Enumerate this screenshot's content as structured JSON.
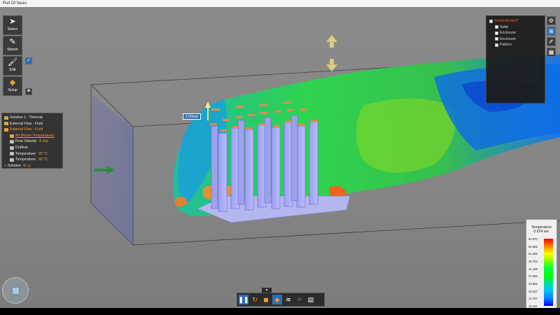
{
  "window": {
    "status_text": "Pull 20 faces"
  },
  "tools": {
    "select_label": "Select",
    "sketch_label": "Sketch",
    "edit_label": "Edit",
    "setup_label": "Setup"
  },
  "simulation_tree": {
    "items": [
      {
        "label": "Solution 1 - Thermal",
        "accent": false
      },
      {
        "label": "External Flow - Fluid",
        "accent": false
      },
      {
        "label": "External Flow - Fluid",
        "accent": true
      },
      {
        "label": "Air [Room Temperature]",
        "accent": true
      },
      {
        "label": "Flow Velocity",
        "value": "6 m/s"
      },
      {
        "label": "Outflow"
      },
      {
        "label": "Temperature",
        "value": "25 °C"
      },
      {
        "label": "Temperature",
        "value": "60 °C"
      }
    ],
    "add_label": "Solution"
  },
  "model_tree": {
    "root": "SimpleModel2*",
    "items": [
      "Solid",
      "Enclosure",
      "Enclosure",
      "Pattern"
    ]
  },
  "dimension_tag": "2.00mm",
  "legend": {
    "title": "Temperature",
    "subtitle": "0.024 sec",
    "values": [
      "80.570",
      "65.866",
      "61.265",
      "46.764",
      "42.166",
      "37.566",
      "32.866",
      "28.267",
      "23.767",
      "19.167"
    ],
    "colors": [
      "#ff0000",
      "#ff8000",
      "#ffff00",
      "#80ff00",
      "#00ff40",
      "#00ff00",
      "#00e0a0",
      "#00c0ff",
      "#0080ff",
      "#0000ff"
    ]
  },
  "bottom_toolbar": {
    "buttons": [
      "pause-icon",
      "loop-icon",
      "box-icon",
      "cube-icon",
      "streamline-icon",
      "particle-icon",
      "surface-icon"
    ]
  }
}
